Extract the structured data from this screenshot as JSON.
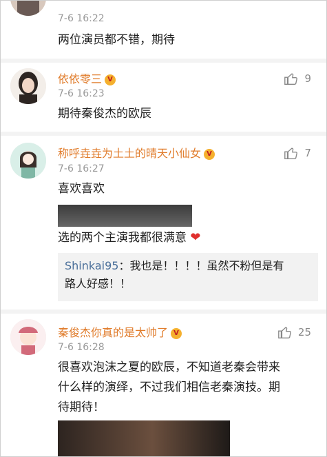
{
  "comments": [
    {
      "name": "",
      "time": "7-6 16:22",
      "text": "两位演员都不错，期待"
    },
    {
      "name": "依依零三",
      "time": "7-6 16:23",
      "likes": "9",
      "text": "期待秦俊杰的欧辰"
    },
    {
      "name": "称呼垚垚为土土的晴天小仙女",
      "time": "7-6 16:27",
      "likes": "7",
      "text1": "喜欢喜欢",
      "text2": "选的两个主演我都很满意",
      "reply_user": "Shinkai95",
      "reply_line1": "：我也是！！！！虽然不粉但是有",
      "reply_line2": "路人好感！！"
    },
    {
      "name": "秦俊杰你真的是太帅了",
      "time": "7-6 16:28",
      "likes": "25",
      "line1": "很喜欢泡沫之夏的欧辰，不知道老秦会带来",
      "line2": "什么样的演绎，不过我们相信老秦演技。期",
      "line3": "待期待！"
    }
  ],
  "icons": {
    "like": "thumbs-up-icon",
    "vip": "vip-crown-icon",
    "heart": "heart-icon"
  },
  "colors": {
    "name": "#e07b2a",
    "reply_user": "#4a6f9a",
    "heart": "#e0302e"
  }
}
